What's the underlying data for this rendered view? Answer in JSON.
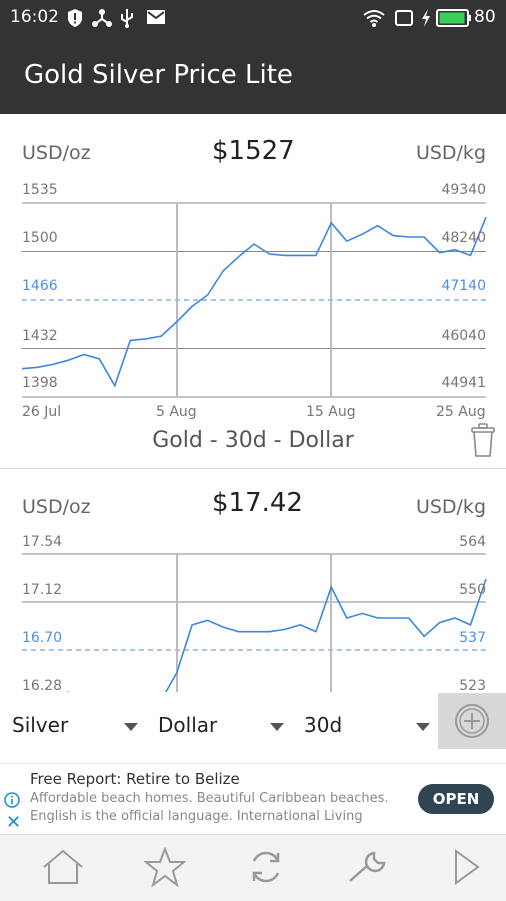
{
  "status": {
    "time": "16:02",
    "battery": "80"
  },
  "app": {
    "title": "Gold Silver Price Lite"
  },
  "gold": {
    "unit_left": "USD/oz",
    "price": "$1527",
    "unit_right": "USD/kg",
    "left_ticks": [
      "1535",
      "1500",
      "1466",
      "1432",
      "1398"
    ],
    "right_ticks": [
      "49340",
      "48240",
      "47140",
      "46040",
      "44941"
    ],
    "x_ticks": [
      "26 Jul",
      "5 Aug",
      "15 Aug",
      "25 Aug"
    ],
    "caption": "Gold - 30d - Dollar"
  },
  "silver": {
    "unit_left": "USD/oz",
    "price": "$17.42",
    "unit_right": "USD/kg",
    "left_ticks": [
      "17.54",
      "17.12",
      "16.70",
      "16.28"
    ],
    "right_ticks": [
      "564",
      "550",
      "537",
      "523"
    ]
  },
  "controls": {
    "metal": "Silver",
    "currency": "Dollar",
    "period": "30d"
  },
  "ad": {
    "title": "Free Report: Retire to Belize",
    "line1": "Affordable beach homes. Beautiful Caribbean beaches.",
    "line2": "English is the official language. International Living",
    "cta": "OPEN"
  },
  "chart_data": [
    {
      "type": "line",
      "title": "Gold - 30d - Dollar",
      "ylabel": "USD/oz",
      "ylim": [
        1398,
        1535
      ],
      "x": [
        "26 Jul",
        "27 Jul",
        "28 Jul",
        "29 Jul",
        "30 Jul",
        "31 Jul",
        "1 Aug",
        "2 Aug",
        "3 Aug",
        "4 Aug",
        "5 Aug",
        "6 Aug",
        "7 Aug",
        "8 Aug",
        "9 Aug",
        "10 Aug",
        "11 Aug",
        "12 Aug",
        "13 Aug",
        "14 Aug",
        "15 Aug",
        "16 Aug",
        "17 Aug",
        "18 Aug",
        "19 Aug",
        "20 Aug",
        "21 Aug",
        "22 Aug",
        "23 Aug",
        "24 Aug",
        "25 Aug"
      ],
      "series": [
        {
          "values": [
            1418,
            1419,
            1421,
            1424,
            1428,
            1425,
            1406,
            1438,
            1439,
            1441,
            1451,
            1462,
            1470,
            1487,
            1497,
            1506,
            1499,
            1498,
            1498,
            1498,
            1521,
            1508,
            1513,
            1519,
            1512,
            1511,
            1511,
            1500,
            1502,
            1498,
            1525
          ]
        }
      ]
    },
    {
      "type": "line",
      "ylabel": "USD/oz",
      "ylim": [
        16.28,
        17.54
      ],
      "x": [
        "26 Jul",
        "27 Jul",
        "28 Jul",
        "29 Jul",
        "30 Jul",
        "31 Jul",
        "1 Aug",
        "2 Aug",
        "3 Aug",
        "4 Aug",
        "5 Aug",
        "6 Aug",
        "7 Aug",
        "8 Aug",
        "9 Aug",
        "10 Aug",
        "11 Aug",
        "12 Aug",
        "13 Aug",
        "14 Aug",
        "15 Aug",
        "16 Aug",
        "17 Aug",
        "18 Aug",
        "19 Aug",
        "20 Aug",
        "21 Aug",
        "22 Aug",
        "23 Aug",
        "24 Aug",
        "25 Aug"
      ],
      "series": [
        {
          "values": [
            16.26,
            16.27,
            16.3,
            16.33,
            16.22,
            16.2,
            16.19,
            16.18,
            16.22,
            16.26,
            16.5,
            16.92,
            16.96,
            16.9,
            16.86,
            16.86,
            16.86,
            16.88,
            16.92,
            16.86,
            17.25,
            16.98,
            17.02,
            16.98,
            16.98,
            16.98,
            16.82,
            16.94,
            16.98,
            16.92,
            17.32
          ]
        }
      ]
    }
  ]
}
